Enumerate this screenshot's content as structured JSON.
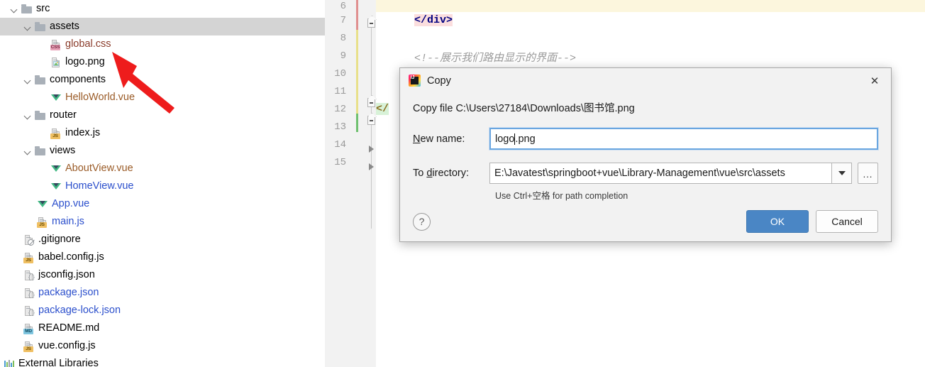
{
  "project_tree": {
    "items": [
      {
        "label": "src",
        "indent": 0,
        "icon": "folder-icon",
        "chevron": "down",
        "color": "c-default",
        "selected": false
      },
      {
        "label": "assets",
        "indent": 1,
        "icon": "folder-icon",
        "chevron": "down",
        "color": "c-default",
        "selected": true
      },
      {
        "label": "global.css",
        "indent": 2,
        "icon": "css-file-icon",
        "chevron": "none",
        "color": "c-brown",
        "selected": false
      },
      {
        "label": "logo.png",
        "indent": 2,
        "icon": "png-file-icon",
        "chevron": "none",
        "color": "c-default",
        "selected": false
      },
      {
        "label": "components",
        "indent": 1,
        "icon": "folder-icon",
        "chevron": "down",
        "color": "c-default",
        "selected": false
      },
      {
        "label": "HelloWorld.vue",
        "indent": 2,
        "icon": "vue-file-icon",
        "chevron": "none",
        "color": "c-orange",
        "selected": false
      },
      {
        "label": "router",
        "indent": 1,
        "icon": "folder-icon",
        "chevron": "down",
        "color": "c-default",
        "selected": false
      },
      {
        "label": "index.js",
        "indent": 2,
        "icon": "js-file-icon",
        "chevron": "none",
        "color": "c-default",
        "selected": false
      },
      {
        "label": "views",
        "indent": 1,
        "icon": "folder-icon",
        "chevron": "down",
        "color": "c-default",
        "selected": false
      },
      {
        "label": "AboutView.vue",
        "indent": 2,
        "icon": "vue-file-icon",
        "chevron": "none",
        "color": "c-orange",
        "selected": false
      },
      {
        "label": "HomeView.vue",
        "indent": 2,
        "icon": "vue-file-icon",
        "chevron": "none",
        "color": "c-blue",
        "selected": false
      },
      {
        "label": "App.vue",
        "indent": 1,
        "icon": "vue-file-icon",
        "chevron": "none",
        "color": "c-blue",
        "selected": false
      },
      {
        "label": "main.js",
        "indent": 1,
        "icon": "js-file-icon",
        "chevron": "none",
        "color": "c-blue",
        "selected": false
      },
      {
        "label": ".gitignore",
        "indent": 0,
        "icon": "gitignore-icon",
        "chevron": "none",
        "color": "c-default",
        "selected": false
      },
      {
        "label": "babel.config.js",
        "indent": 0,
        "icon": "js-file-icon",
        "chevron": "none",
        "color": "c-default",
        "selected": false
      },
      {
        "label": "jsconfig.json",
        "indent": 0,
        "icon": "json-file-icon",
        "chevron": "none",
        "color": "c-default",
        "selected": false
      },
      {
        "label": "package.json",
        "indent": 0,
        "icon": "json-file-icon",
        "chevron": "none",
        "color": "c-blue",
        "selected": false
      },
      {
        "label": "package-lock.json",
        "indent": 0,
        "icon": "json-file-icon",
        "chevron": "none",
        "color": "c-blue",
        "selected": false
      },
      {
        "label": "README.md",
        "indent": 0,
        "icon": "md-file-icon",
        "chevron": "none",
        "color": "c-default",
        "selected": false
      },
      {
        "label": "vue.config.js",
        "indent": 0,
        "icon": "js-file-icon",
        "chevron": "none",
        "color": "c-default",
        "selected": false
      },
      {
        "label": "External Libraries",
        "indent": -1,
        "icon": "libraries-icon",
        "chevron": "none",
        "color": "c-default",
        "selected": false
      }
    ],
    "annotation": {
      "shape": "red-arrow",
      "color": "#ee1c1c",
      "points_to": "logo.png"
    }
  },
  "editor": {
    "line_numbers": [
      "6",
      "7",
      "8",
      "9",
      "10",
      "11",
      "12",
      "13",
      "14",
      "15"
    ],
    "code_lines": [
      {
        "line": "7",
        "text": "</div>",
        "highlight": "pink"
      },
      {
        "line": "9",
        "text": "<!--展示我们路由显示的界面-->",
        "highlight": "none"
      },
      {
        "line": "12",
        "text": "</",
        "highlight": "green"
      }
    ],
    "change_bars": [
      {
        "color": "#e08f8f",
        "label": "modified"
      },
      {
        "color": "#e8e08a",
        "label": "changed"
      },
      {
        "color": "#6fc06f",
        "label": "added"
      }
    ]
  },
  "dialog": {
    "title": "Copy",
    "app_icon_text": "IJ",
    "close_label": "✕",
    "source_text": "Copy file C:\\Users\\27184\\Downloads\\图书馆.png",
    "new_name": {
      "label_prefix": "N",
      "label_rest": "ew name:",
      "value_before_caret": "logo",
      "value_after_caret": ".png"
    },
    "to_directory": {
      "label_prefix": "To ",
      "label_underlined": "d",
      "label_rest": "irectory:",
      "value": "E:\\Javatest\\springboot+vue\\Library-Management\\vue\\src\\assets",
      "dropdown_icon": "chevron-down-icon",
      "browse_label": "..."
    },
    "path_hint": "Use Ctrl+空格 for path completion",
    "help_label": "?",
    "ok_label": "OK",
    "cancel_label": "Cancel",
    "colors": {
      "ok_button": "#4a86c5",
      "focus_border": "#6aa6e0",
      "dialog_bg": "#f2f2f2"
    }
  }
}
